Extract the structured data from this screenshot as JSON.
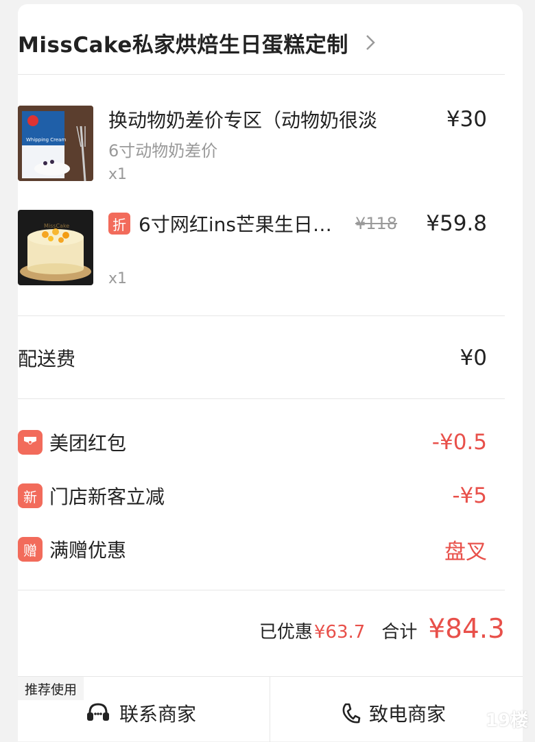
{
  "store": {
    "name": "MissCake私家烘焙生日蛋糕定制"
  },
  "items": [
    {
      "title": "换动物奶差价专区（动物奶很淡",
      "subtitle": "6寸动物奶差价",
      "qty": "x1",
      "price": "¥30",
      "image_text": "Whipping Cream"
    },
    {
      "tag": "折",
      "title": "6寸网红ins芒果生日…",
      "original_price": "¥118",
      "qty": "x1",
      "price": "¥59.8",
      "image_text": "MissCake"
    }
  ],
  "delivery": {
    "label": "配送费",
    "value": "¥0"
  },
  "promotions": [
    {
      "icon": "red-packet-icon",
      "icon_text": "",
      "label": "美团红包",
      "value": "-¥0.5"
    },
    {
      "icon": "new-customer-icon",
      "icon_text": "新",
      "label": "门店新客立减",
      "value": "-¥5"
    },
    {
      "icon": "gift-icon",
      "icon_text": "赠",
      "label": "满赠优惠",
      "value": "盘叉"
    }
  ],
  "summary": {
    "saved_label": "已优惠",
    "saved_value": "¥63.7",
    "total_label": "合计",
    "total_value": "¥84.3"
  },
  "bottom": {
    "recommend": "推荐使用",
    "contact": "联系商家",
    "call": "致电商家"
  },
  "watermark": "19楼",
  "colors": {
    "accent_red": "#e8504a",
    "tag_red": "#f26b5b"
  }
}
